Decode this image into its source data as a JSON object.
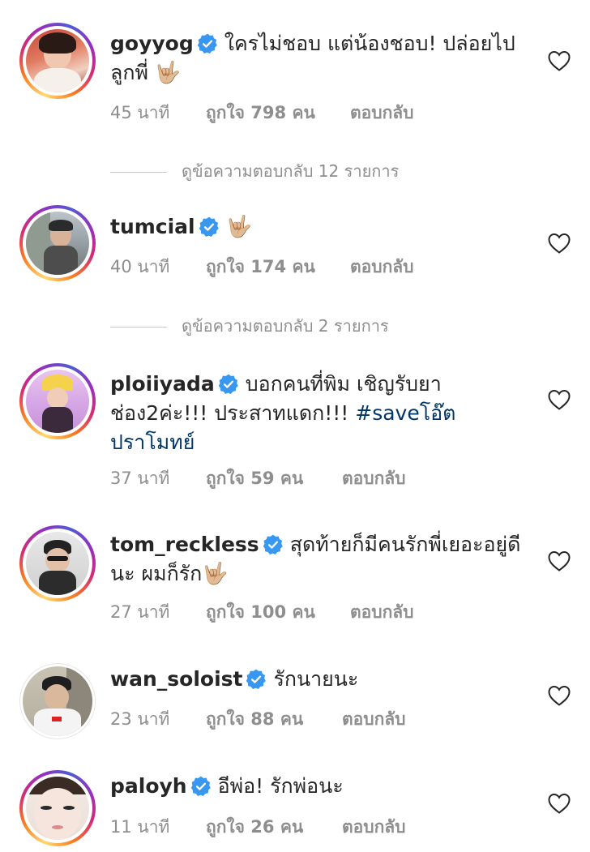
{
  "comments": [
    {
      "username": "goyyog",
      "text": "ใครไม่ชอบ แต่น้องชอบ! ปล่อยไปลูกพี่",
      "emoji": "🤟🏼",
      "time": "45 นาที",
      "likes": "ถูกใจ 798 คน",
      "reply": "ตอบกลับ",
      "view_replies": "ดูข้อความตอบกลับ 12 รายการ"
    },
    {
      "username": "tumcial",
      "text": "",
      "emoji": "🤟🏼",
      "time": "40 นาที",
      "likes": "ถูกใจ 174 คน",
      "reply": "ตอบกลับ",
      "view_replies": "ดูข้อความตอบกลับ 2 รายการ"
    },
    {
      "username": "ploiiyada",
      "text": "บอกคนที่พิม เชิญรับยาช่อง2ค่ะ!!! ประสาทแดก!!!",
      "hashtag": "#saveโอ๊ตปราโมทย์",
      "time": "37 นาที",
      "likes": "ถูกใจ 59 คน",
      "reply": "ตอบกลับ"
    },
    {
      "username": "tom_reckless",
      "text": "สุดท้ายก็มีคนรักพี่เยอะอยู่ดีนะ ผมก็รัก",
      "emoji": "🤟🏼",
      "time": "27 นาที",
      "likes": "ถูกใจ 100 คน",
      "reply": "ตอบกลับ"
    },
    {
      "username": "wan_soloist",
      "text": "รักนายนะ",
      "time": "23 นาที",
      "likes": "ถูกใจ 88 คน",
      "reply": "ตอบกลับ"
    },
    {
      "username": "paloyh",
      "text": "อีพ่อ! รักพ่อนะ",
      "time": "11 นาที",
      "likes": "ถูกใจ 26 คน",
      "reply": "ตอบกลับ"
    }
  ],
  "colors": {
    "verified": "#3897f0",
    "meta": "#8e8e8e",
    "hashtag": "#00376b"
  }
}
